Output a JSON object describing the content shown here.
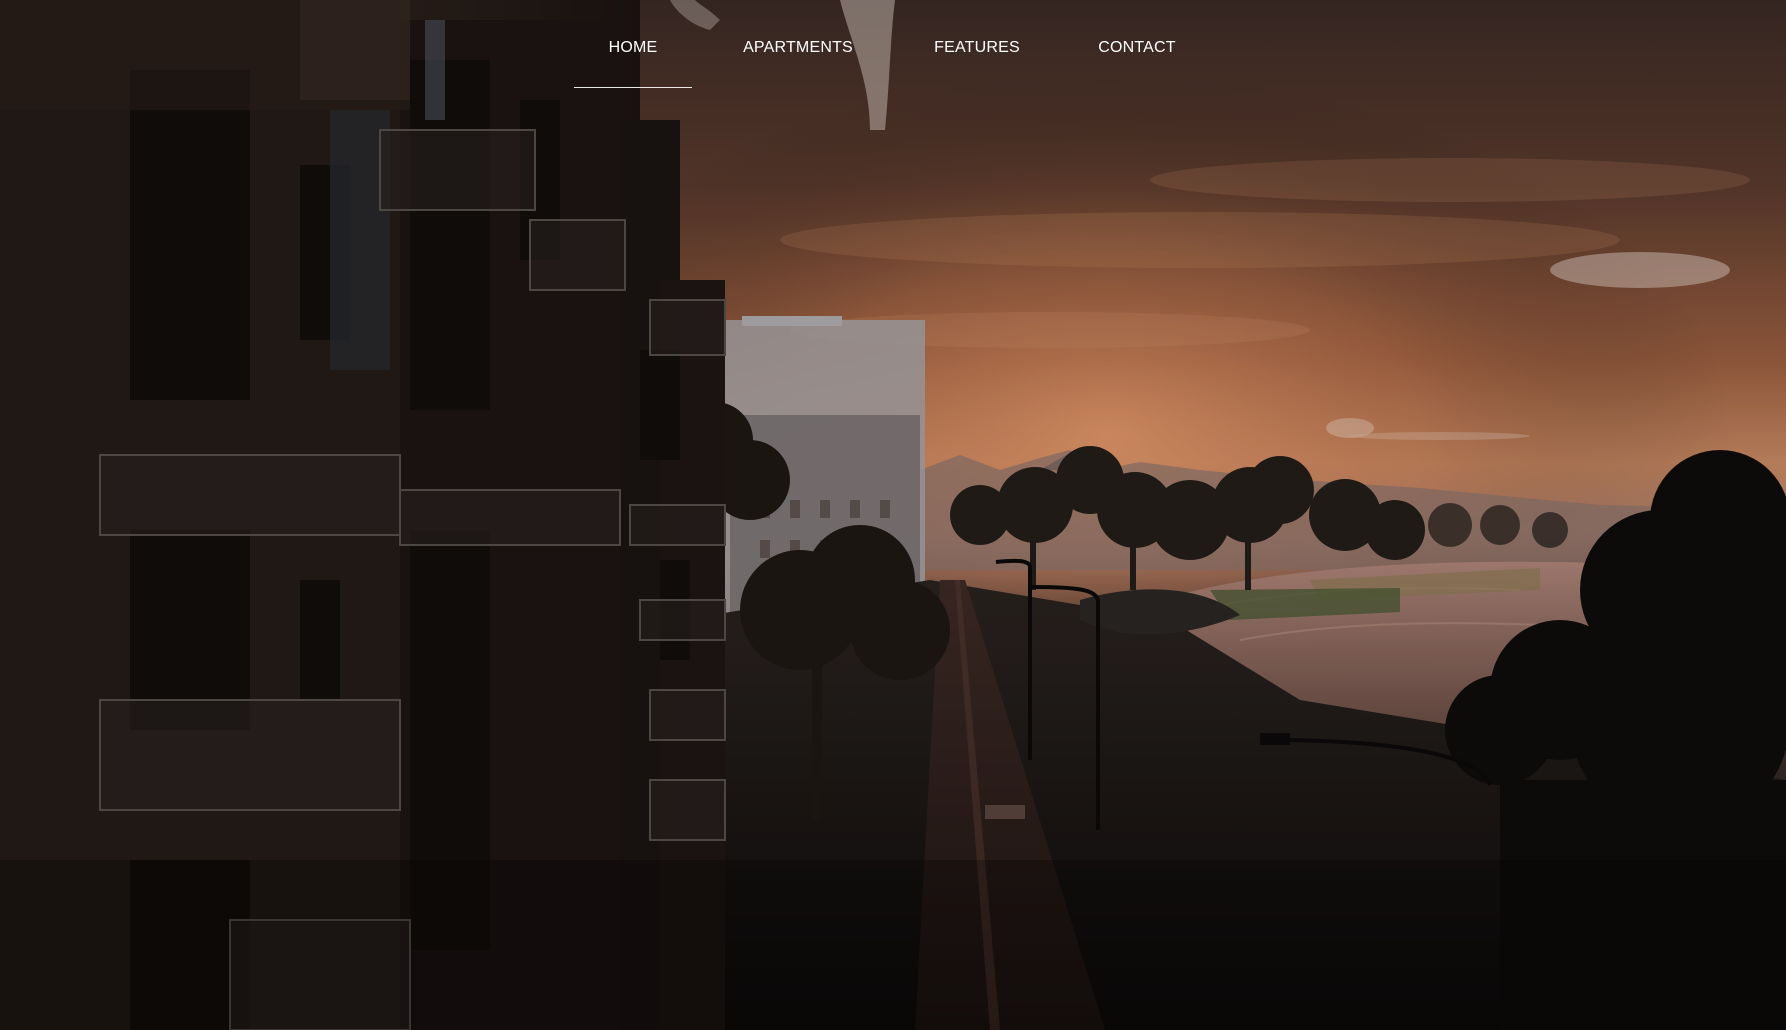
{
  "nav": {
    "items": [
      {
        "label": "HOME",
        "active": true
      },
      {
        "label": "APARTMENTS",
        "active": false
      },
      {
        "label": "FEATURES",
        "active": false
      },
      {
        "label": "CONTACT",
        "active": false
      }
    ]
  },
  "colors": {
    "sky_glow": "#d8875a",
    "sky_dark": "#3a2a26",
    "water": "#8a6a5c",
    "foreground": "#0e0c0b",
    "nav_text": "#ffffff"
  }
}
